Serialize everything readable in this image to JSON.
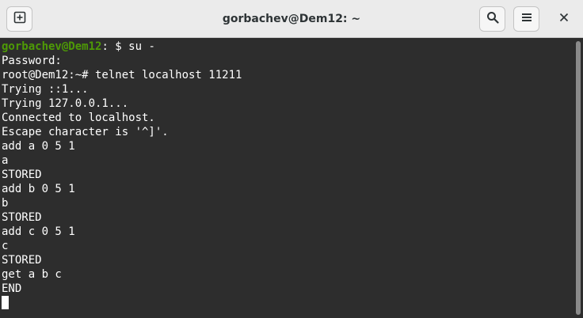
{
  "window": {
    "title": "gorbachev@Dem12: ~"
  },
  "toolbar": {
    "new_tab_icon": "new-tab-icon",
    "search_icon": "search-icon",
    "menu_icon": "hamburger-menu-icon",
    "close_icon": "close-icon"
  },
  "terminal": {
    "prompt_user_host": "gorbachev@Dem12",
    "prompt_path": ":",
    "prompt_suffix": " $ su -",
    "lines": [
      "Password:",
      "root@Dem12:~# telnet localhost 11211",
      "Trying ::1...",
      "Trying 127.0.0.1...",
      "Connected to localhost.",
      "Escape character is '^]'.",
      "add a 0 5 1",
      "a",
      "STORED",
      "add b 0 5 1",
      "b",
      "STORED",
      "add c 0 5 1",
      "c",
      "STORED",
      "get a b c",
      "END"
    ]
  },
  "colors": {
    "terminal_bg": "#2d2d2d",
    "text": "#ffffff",
    "user_host": "#4e9a06",
    "titlebar_bg": "#ebebeb"
  }
}
